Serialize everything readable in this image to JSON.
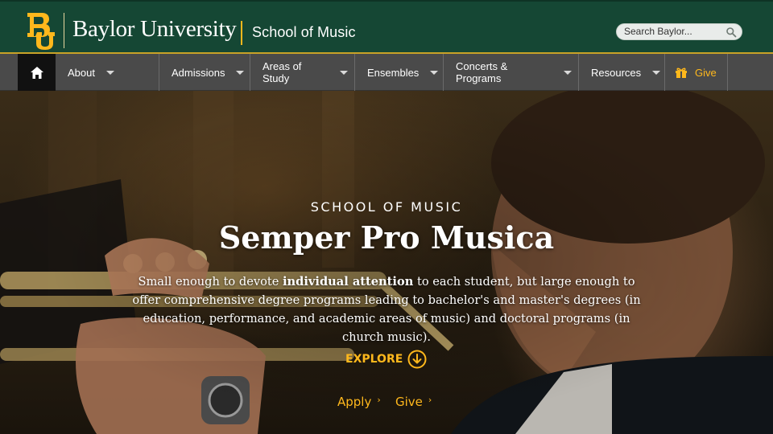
{
  "header": {
    "wordmark": "Baylor University",
    "site_name": "School of Music",
    "search_placeholder": "Search Baylor...",
    "logo_icon": "bu-monogram-icon"
  },
  "nav": {
    "items": [
      {
        "label": "About"
      },
      {
        "label": "Admissions"
      },
      {
        "label": "Areas of Study"
      },
      {
        "label": "Ensembles"
      },
      {
        "label": "Concerts & Programs"
      },
      {
        "label": "Resources"
      }
    ],
    "give_label": "Give"
  },
  "hero": {
    "kicker": "SCHOOL OF MUSIC",
    "headline": "Semper Pro Musica",
    "body_before": "Small enough to devote ",
    "body_bold": "individual attention",
    "body_after": " to each student, but large enough to offer comprehensive degree programs leading to bachelor's and master's degrees (in education, performance, and academic areas of music) and doctoral programs (in church music).",
    "explore_label": "EXPLORE",
    "apply_label": "Apply",
    "give_label": "Give"
  },
  "colors": {
    "brand_green": "#154734",
    "brand_gold": "#ffb81c",
    "nav_gray": "#4a4a4a"
  }
}
